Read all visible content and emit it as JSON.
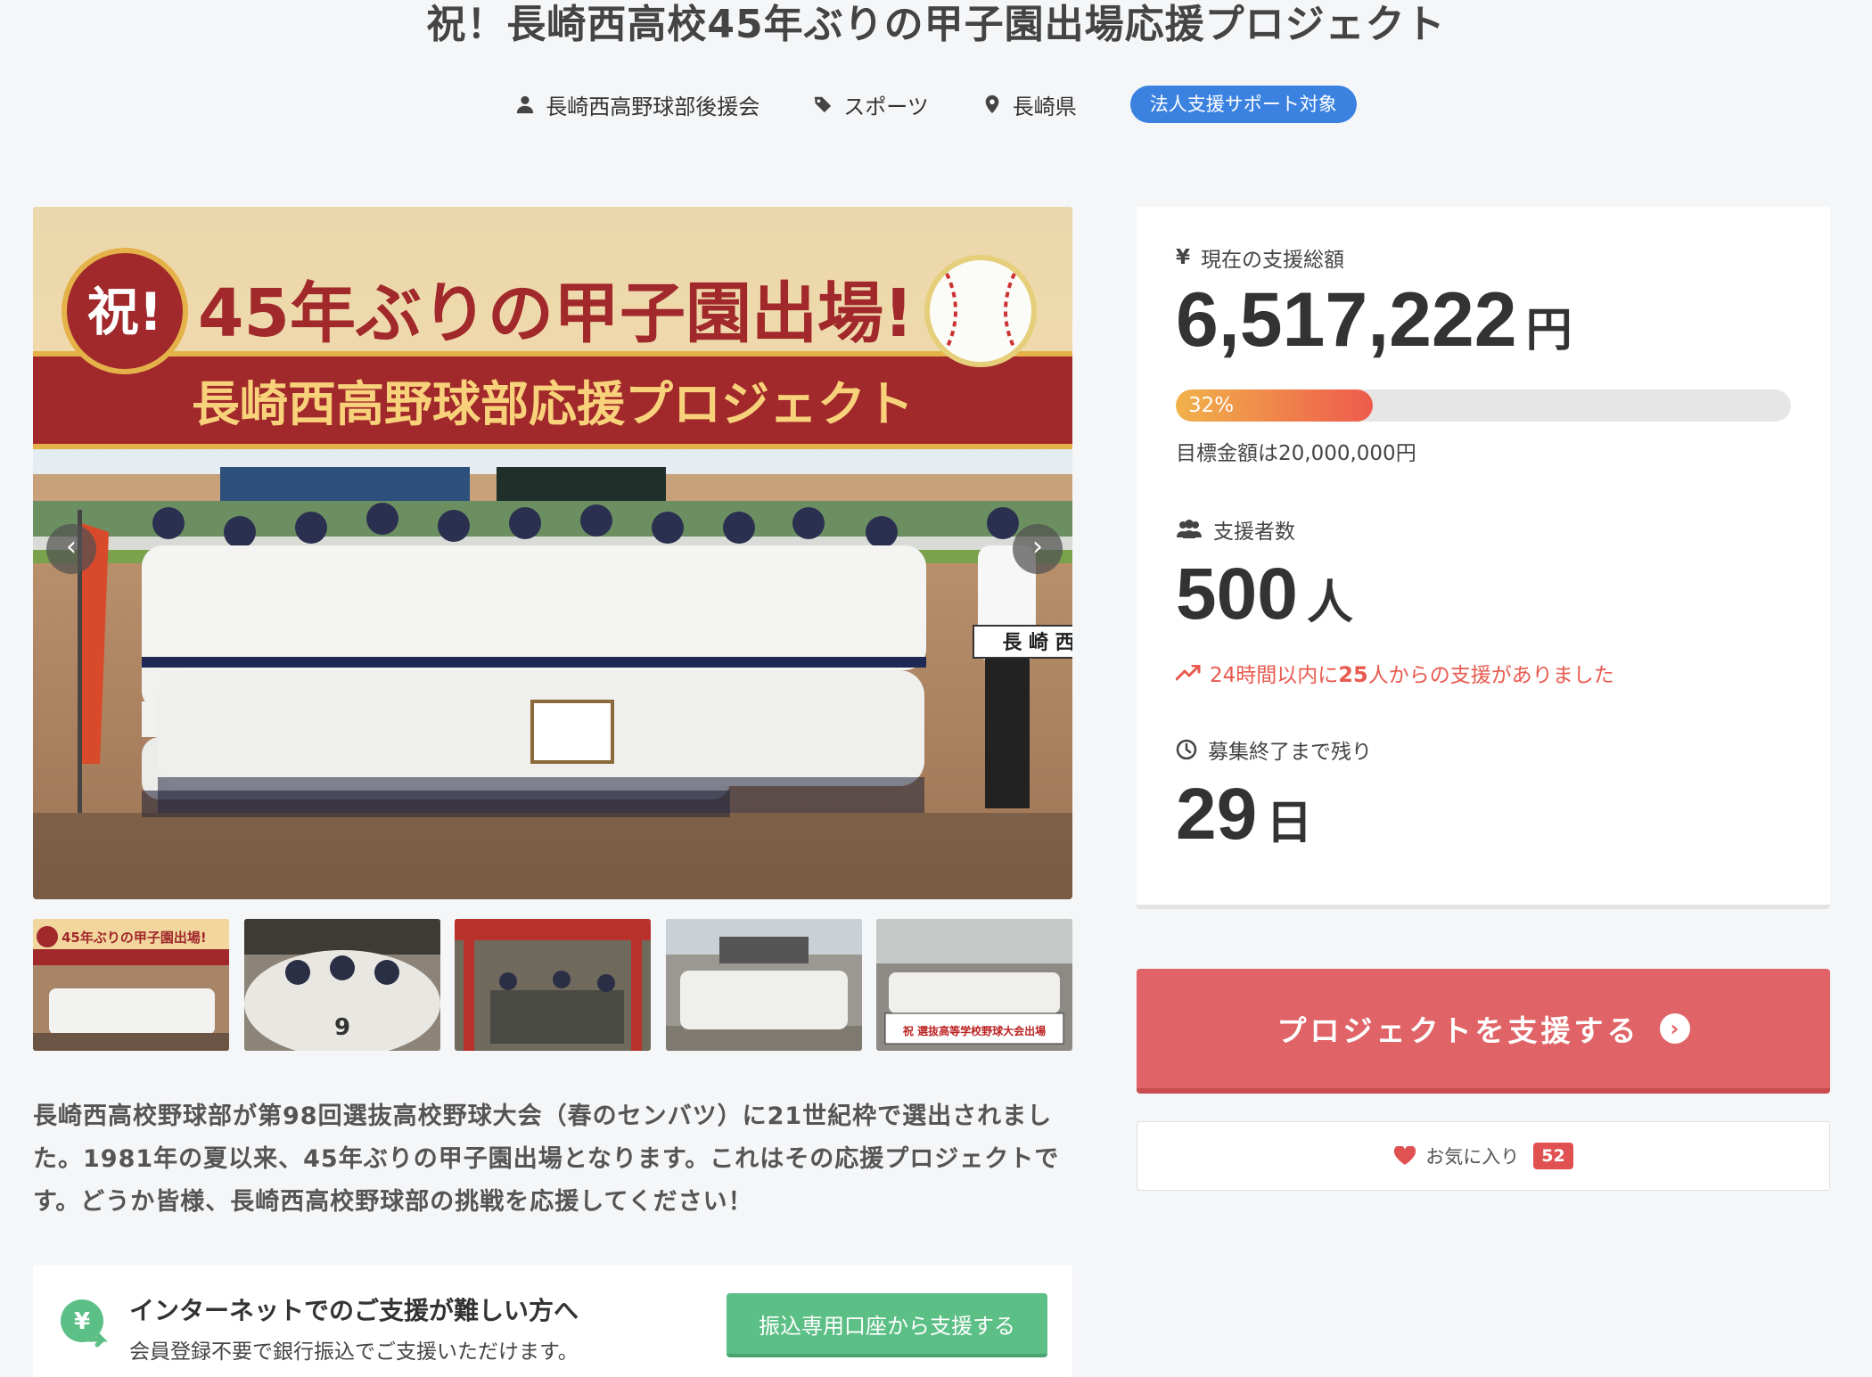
{
  "project": {
    "title": "祝！長崎西高校45年ぶりの甲子園出場応援プロジェクト",
    "owner": "長崎西高野球部後援会",
    "category": "スポーツ",
    "location": "長崎県",
    "badge": "法人支援サポート対象"
  },
  "hero": {
    "banner_mark": "祝!",
    "banner_headline": "45年ぶりの甲子園出場!",
    "banner_sub": "長崎西高野球部応援プロジェクト",
    "sign_text": "長 崎 西",
    "prev_icon": "chevron-left-icon",
    "next_icon": "chevron-right-icon"
  },
  "thumbnails": [
    {
      "name": "thumb-banner",
      "overlay": "45年ぶりの甲子園出場!"
    },
    {
      "name": "thumb-huddle",
      "overlay": ""
    },
    {
      "name": "thumb-shrine",
      "overlay": ""
    },
    {
      "name": "thumb-team-stadium",
      "overlay": ""
    },
    {
      "name": "thumb-team-school",
      "overlay": "祝 選抜高等学校野球大会出場"
    }
  ],
  "description": "長崎西高校野球部が第98回選抜高校野球大会（春のセンバツ）に21世紀枠で選出されました。1981年の夏以来、45年ぶりの甲子園出場となります。これはその応援プロジェクトです。どうか皆様、長崎西高校野球部の挑戦を応援してください！",
  "bank": {
    "title": "インターネットでのご支援が難しい方へ",
    "subtitle": "会員登録不要で銀行振込でご支援いただけます。",
    "button": "振込専用口座から支援する"
  },
  "stats": {
    "amount_label": "現在の支援総額",
    "amount": "6,517,222",
    "amount_unit": "円",
    "progress_percent": 32,
    "progress_label": "32%",
    "goal": "目標金額は20,000,000円",
    "supporters_label": "支援者数",
    "supporters": "500",
    "supporters_unit": "人",
    "recent_prefix": "24時間以内に",
    "recent_count": "25",
    "recent_suffix": "人からの支援がありました",
    "remaining_label": "募集終了まで残り",
    "remaining": "29",
    "remaining_unit": "日"
  },
  "actions": {
    "support_button": "プロジェクトを支援する",
    "favorite_label": "お気に入り",
    "favorite_count": "52"
  },
  "colors": {
    "accent_blue": "#3b82e0",
    "support_red": "#e06467",
    "bank_green": "#5cbf86",
    "progress_start": "#f1b24a",
    "progress_end": "#ee5a4c"
  }
}
